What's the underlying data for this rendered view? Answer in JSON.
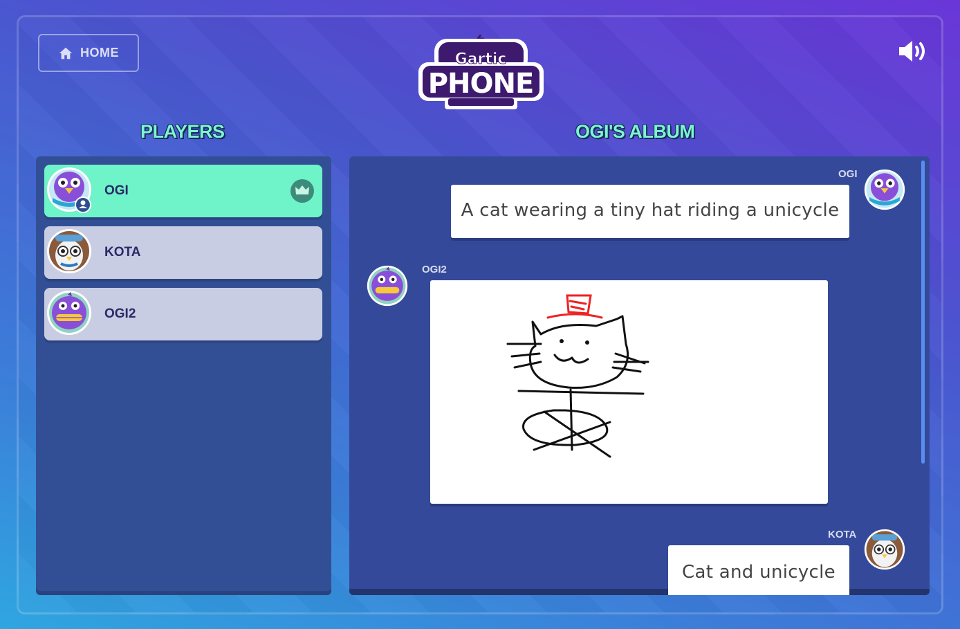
{
  "header": {
    "home_label": "HOME",
    "home_icon": "home-icon",
    "sound_icon": "speaker-icon",
    "logo_top": "Gartic",
    "logo_bottom": "PHONE"
  },
  "players_section": {
    "title": "PLAYERS",
    "players": [
      {
        "name": "OGI",
        "avatar": "purple-bird-avatar",
        "host": true,
        "is_you": true
      },
      {
        "name": "KOTA",
        "avatar": "pilot-owl-avatar",
        "host": false
      },
      {
        "name": "OGI2",
        "avatar": "purple-dino-avatar",
        "host": false
      }
    ]
  },
  "album_section": {
    "title": "OGI'S ALBUM",
    "messages": [
      {
        "author": "OGI",
        "type": "text",
        "text": "A cat wearing a tiny hat riding a unicycle"
      },
      {
        "author": "OGI2",
        "type": "drawing",
        "drawing": "cat with red hat on unicycle sketch"
      },
      {
        "author": "KOTA",
        "type": "text",
        "text": "Cat and unicycle"
      }
    ]
  },
  "colors": {
    "accent": "#6ff3c8",
    "panel": "#324f96",
    "player_idle": "#c8cde3",
    "name_text": "#2a2a66",
    "logo_purple": "#3d1a6e"
  }
}
